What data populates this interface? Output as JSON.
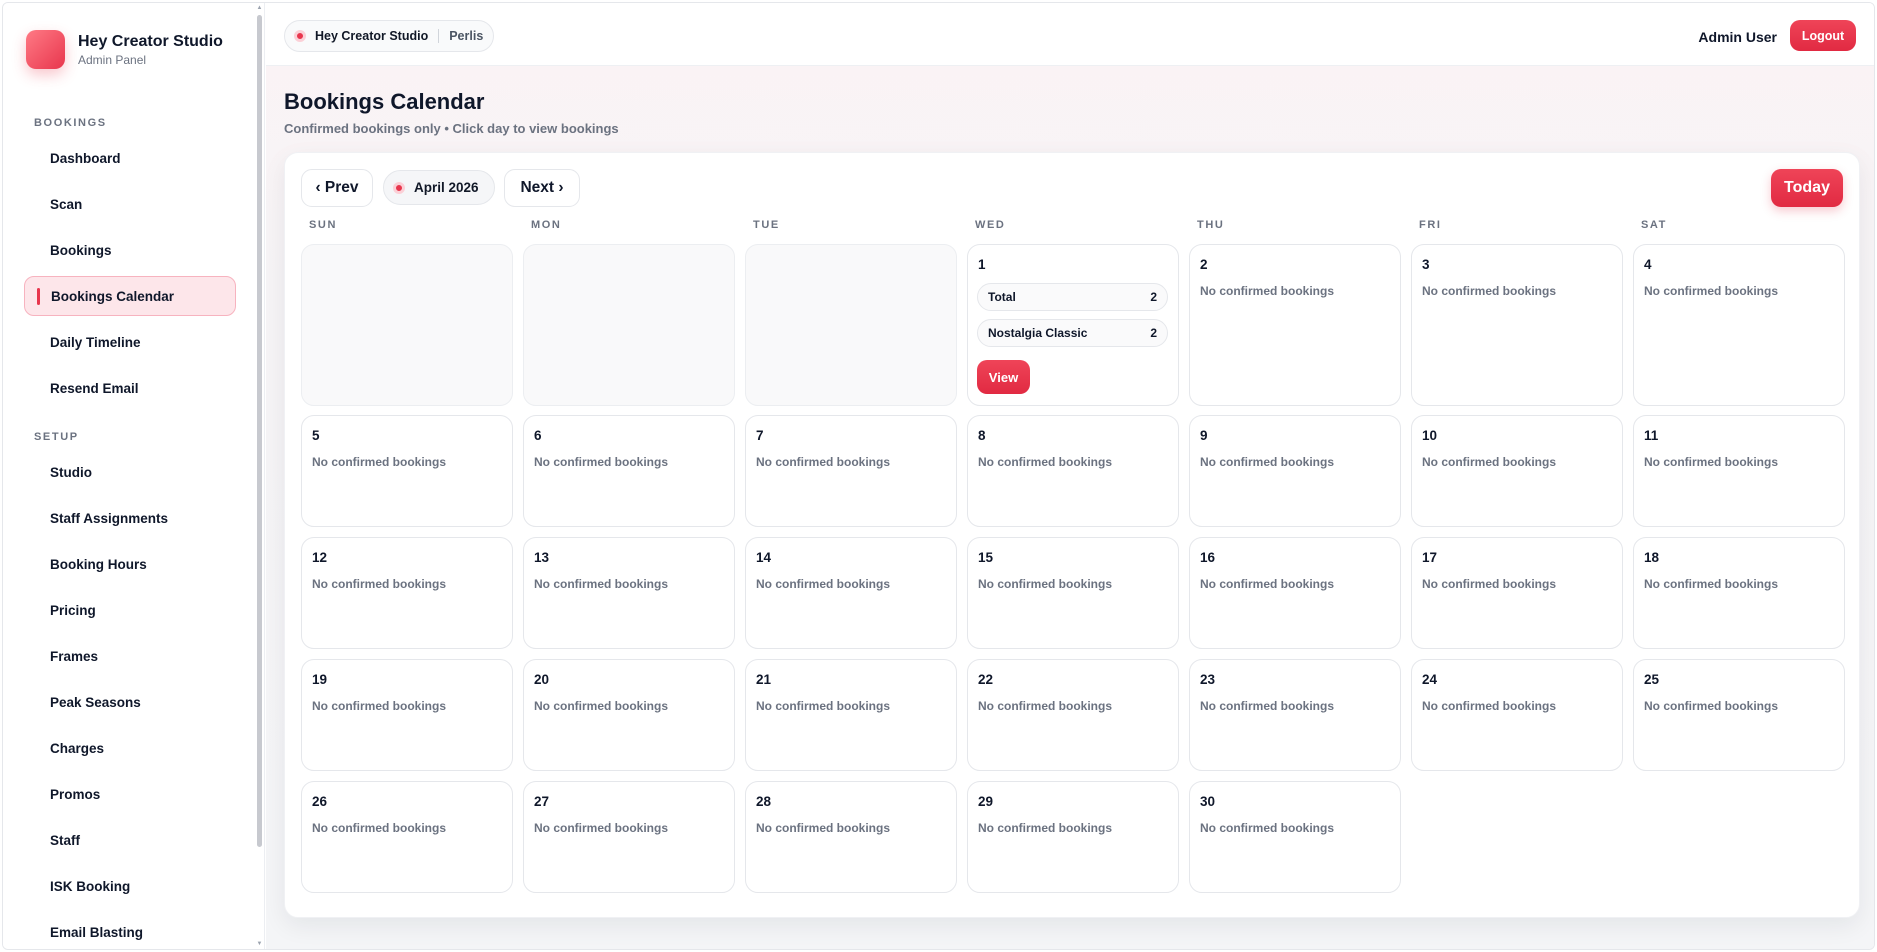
{
  "app": {
    "brand_title": "Hey Creator Studio",
    "brand_subtitle": "Admin Panel"
  },
  "sidebar": {
    "sections": [
      {
        "label": "BOOKINGS",
        "items": [
          "Dashboard",
          "Scan",
          "Bookings",
          "Bookings Calendar",
          "Daily Timeline",
          "Resend Email"
        ]
      },
      {
        "label": "SETUP",
        "items": [
          "Studio",
          "Staff Assignments",
          "Booking Hours",
          "Pricing",
          "Frames",
          "Peak Seasons",
          "Charges",
          "Promos",
          "Staff",
          "ISK Booking",
          "Email Blasting"
        ]
      }
    ],
    "active_item": "Bookings Calendar"
  },
  "topbar": {
    "studio_name": "Hey Creator Studio",
    "location": "Perlis",
    "user_name": "Admin User",
    "logout_label": "Logout"
  },
  "page": {
    "title": "Bookings Calendar",
    "subtitle": "Confirmed bookings only • Click day to view bookings"
  },
  "calendar": {
    "prev_label": "‹ Prev",
    "next_label": "Next ›",
    "month_label": "April 2026",
    "today_label": "Today",
    "weekdays": [
      "SUN",
      "MON",
      "TUE",
      "WED",
      "THU",
      "FRI",
      "SAT"
    ],
    "leading_empty_days": 3,
    "days_in_month": 30,
    "empty_text": "No confirmed bookings",
    "booked_days": {
      "1": {
        "stats": [
          {
            "label": "Total",
            "count": "2"
          },
          {
            "label": "Nostalgia Classic",
            "count": "2"
          }
        ],
        "view_label": "View"
      }
    }
  },
  "colors": {
    "accent": "#e8364d",
    "accent_soft": "#fde6ea",
    "text": "#0f172a",
    "muted": "#6b7280"
  }
}
